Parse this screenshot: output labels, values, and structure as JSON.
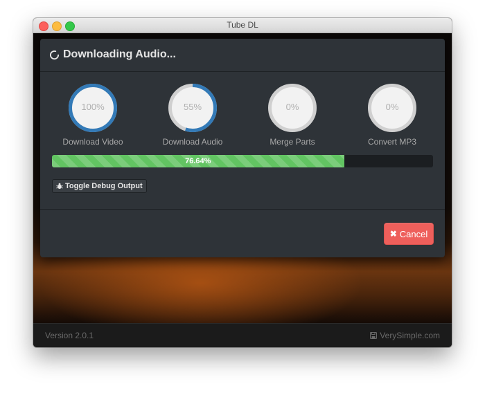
{
  "window": {
    "title": "Tube DL"
  },
  "modal": {
    "title": "Downloading Audio..."
  },
  "steps": [
    {
      "label": "Download Video",
      "percent_text": "100%",
      "progress": 1.0
    },
    {
      "label": "Download Audio",
      "percent_text": "55%",
      "progress": 0.55
    },
    {
      "label": "Merge Parts",
      "percent_text": "0%",
      "progress": 0
    },
    {
      "label": "Convert MP3",
      "percent_text": "0%",
      "progress": 0
    }
  ],
  "progress": {
    "text": "76.64%",
    "fraction": 0.7664
  },
  "debug_button": {
    "label": "Toggle Debug Output",
    "icon": "bug-icon"
  },
  "cancel_button": {
    "label": "Cancel",
    "icon": "close-icon"
  },
  "footer": {
    "version": "Version 2.0.1",
    "site": "VerySimple.com",
    "site_icon": "save-icon"
  },
  "colors": {
    "ring_track": "#d0d0d0",
    "ring_fill": "#337ab7",
    "progress_fill": "#62c462",
    "cancel": "#ee5f5b",
    "modal_bg": "#2e3338"
  }
}
